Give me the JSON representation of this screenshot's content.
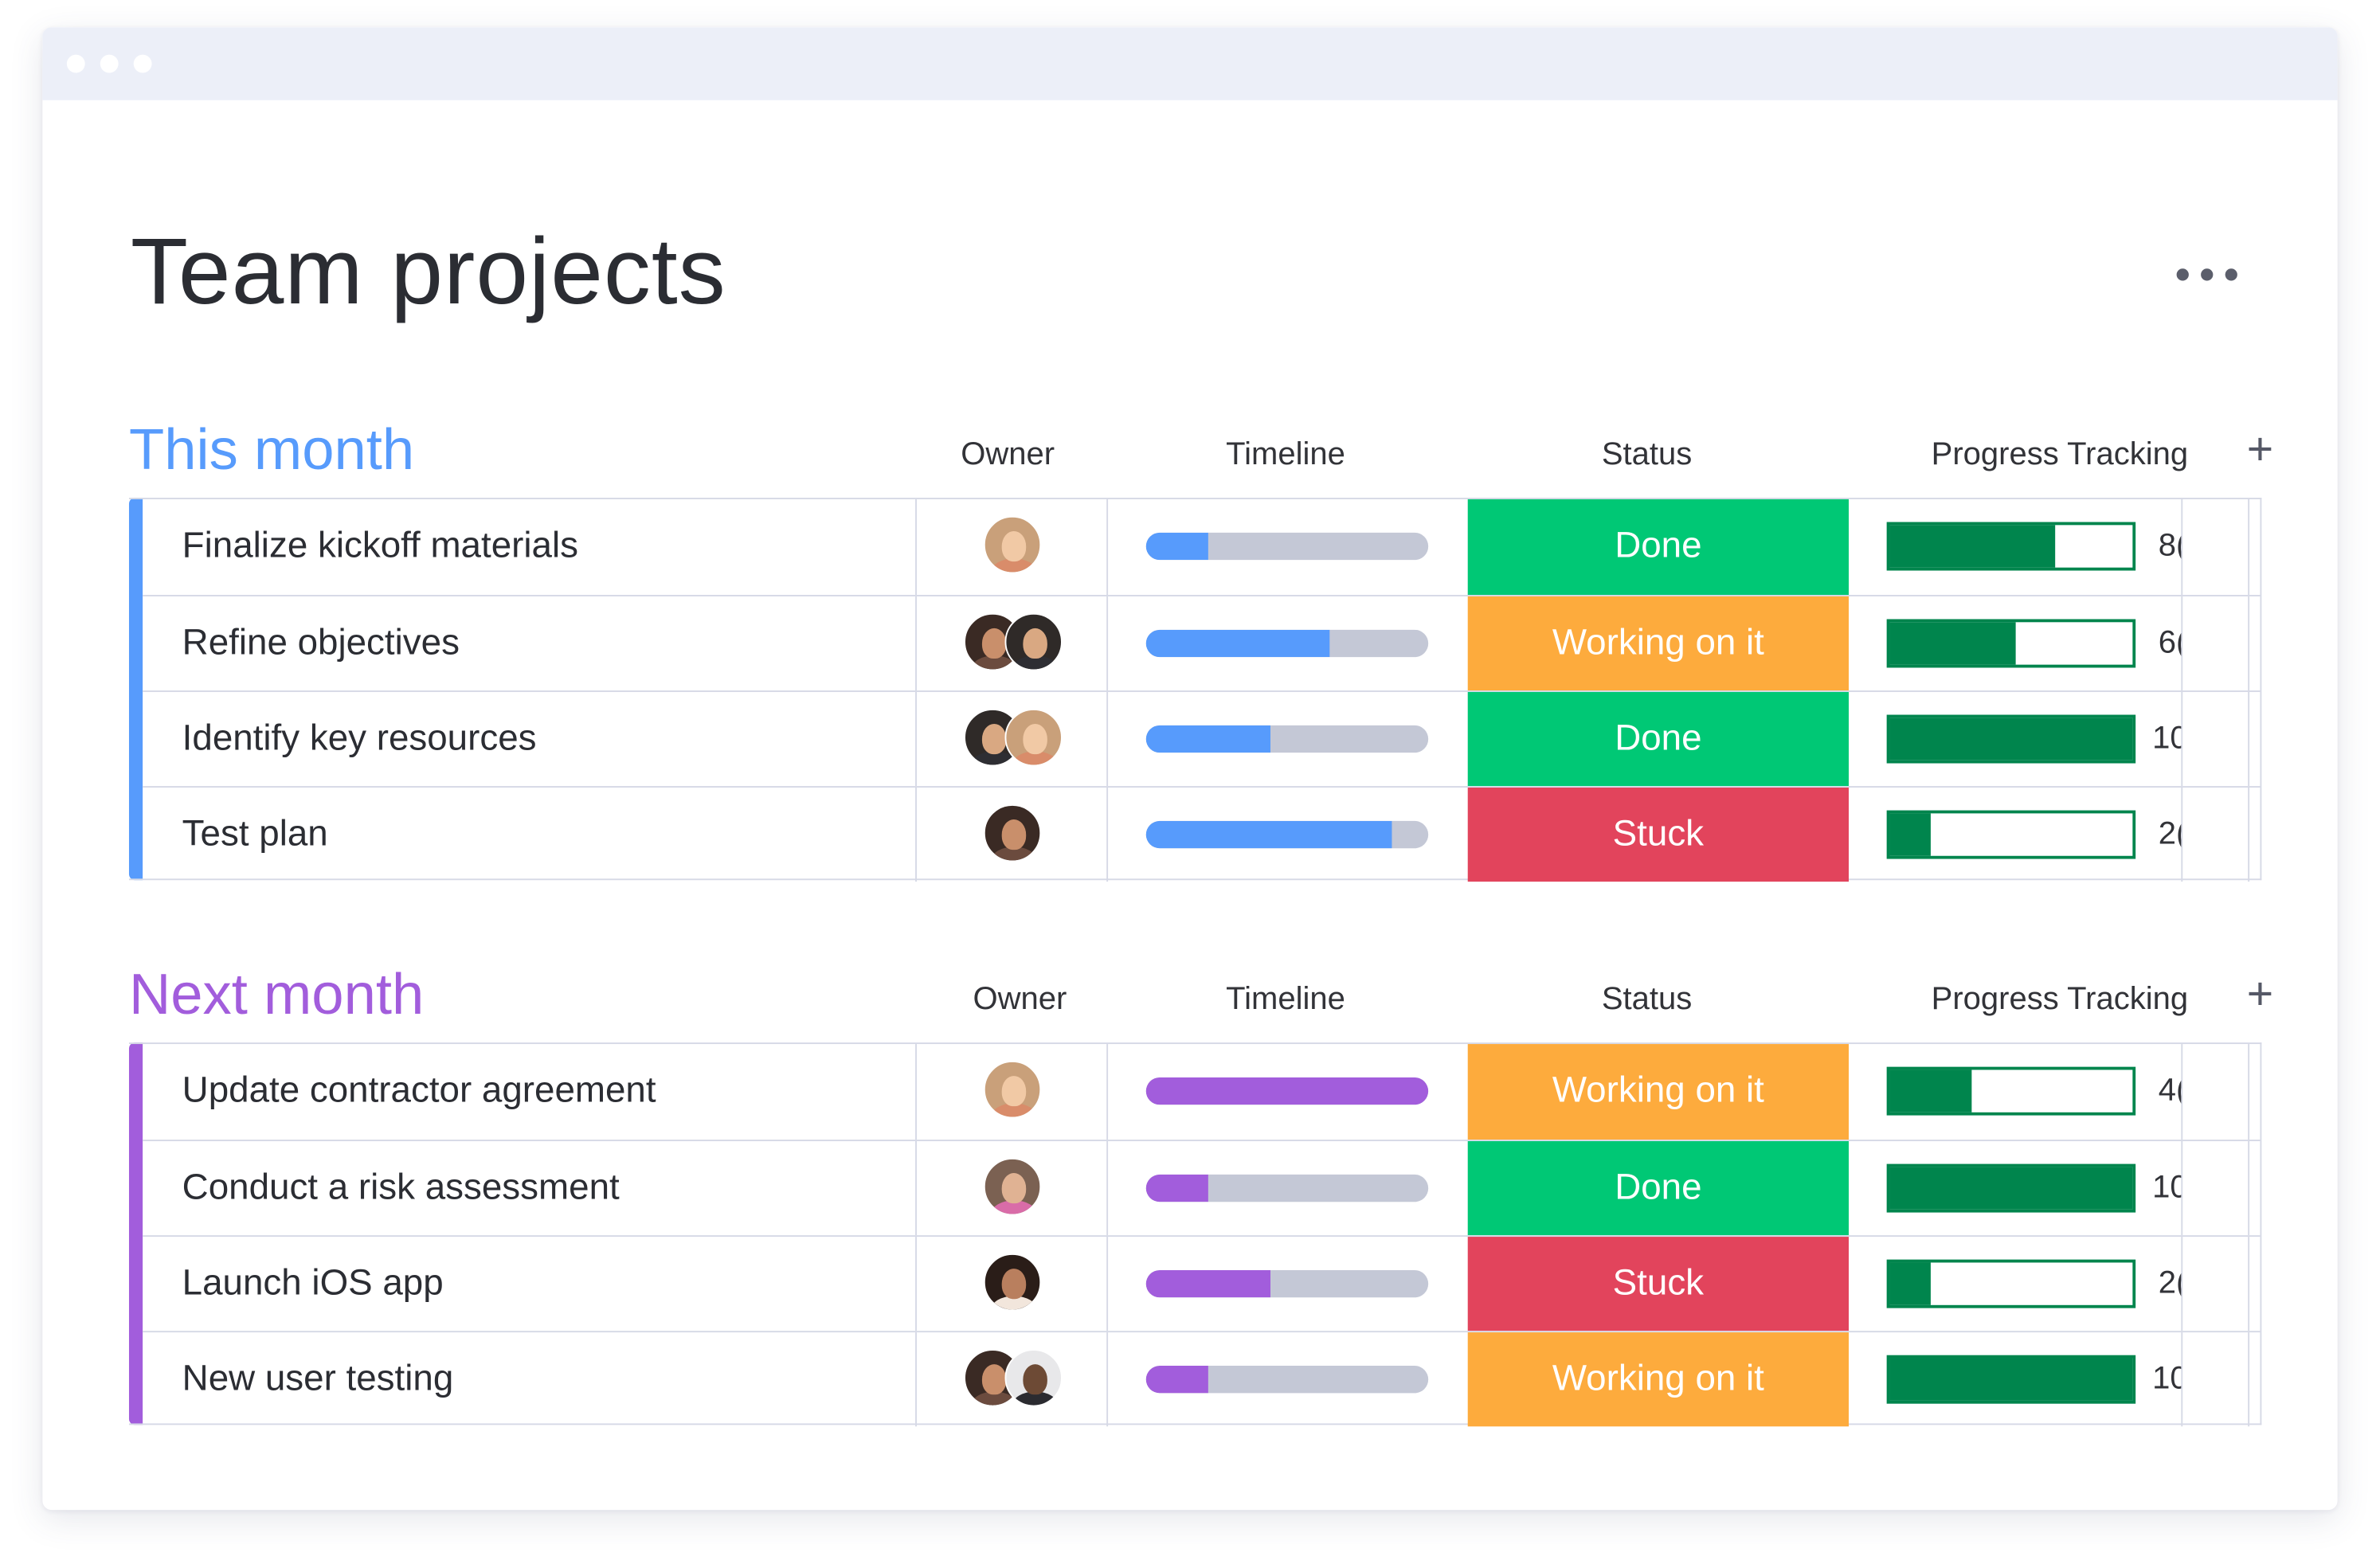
{
  "board": {
    "title": "Team projects"
  },
  "colors": {
    "done": "#00c875",
    "working": "#fdab3d",
    "stuck": "#e2445c",
    "progress": "#00854d",
    "this_month": "#579bfc",
    "next_month": "#a25ddc",
    "track": "#c4c8d6"
  },
  "icons": {
    "more": "ellipsis-icon",
    "add_column": "plus-icon"
  },
  "groups": [
    {
      "title": "This month",
      "color": "#579bfc",
      "columns": {
        "owner": "Owner",
        "timeline": "Timeline",
        "status": "Status",
        "progress": "Progress Tracking"
      },
      "items": [
        {
          "name": "Finalize kickoff materials",
          "owners": [
            "woman-light-hair"
          ],
          "timeline": 0.22,
          "status": "Done",
          "status_key": "done",
          "progress": 0.68,
          "progress_label": "8("
        },
        {
          "name": "Refine objectives",
          "owners": [
            "woman-dark-hair",
            "man-dark-hair"
          ],
          "timeline": 0.65,
          "status": "Working on it",
          "status_key": "working",
          "progress": 0.52,
          "progress_label": "6("
        },
        {
          "name": "Identify key resources",
          "owners": [
            "man-dark-hair",
            "woman-light-hair"
          ],
          "timeline": 0.44,
          "status": "Done",
          "status_key": "done",
          "progress": 1.0,
          "progress_label": "10"
        },
        {
          "name": "Test plan",
          "owners": [
            "woman-dark-hair"
          ],
          "timeline": 0.87,
          "status": "Stuck",
          "status_key": "stuck",
          "progress": 0.17,
          "progress_label": "2("
        }
      ]
    },
    {
      "title": "Next month",
      "color": "#a25ddc",
      "columns": {
        "owner": "Owner",
        "timeline": "Timeline",
        "status": "Status",
        "progress": "Progress Tracking"
      },
      "items": [
        {
          "name": "Update contractor agreement",
          "owners": [
            "woman-light-hair"
          ],
          "timeline": 1.0,
          "status": "Working on it",
          "status_key": "working",
          "progress": 0.34,
          "progress_label": "4("
        },
        {
          "name": "Conduct a risk assessment",
          "owners": [
            "man-beard"
          ],
          "timeline": 0.22,
          "status": "Done",
          "status_key": "done",
          "progress": 1.0,
          "progress_label": "10"
        },
        {
          "name": "Launch iOS app",
          "owners": [
            "woman-curly-hair"
          ],
          "timeline": 0.44,
          "status": "Stuck",
          "status_key": "stuck",
          "progress": 0.17,
          "progress_label": "2("
        },
        {
          "name": "New user testing",
          "owners": [
            "woman-dark-hair",
            "man-bald"
          ],
          "timeline": 0.22,
          "status": "Working on it",
          "status_key": "working",
          "progress": 1.0,
          "progress_label": "10"
        }
      ]
    }
  ]
}
